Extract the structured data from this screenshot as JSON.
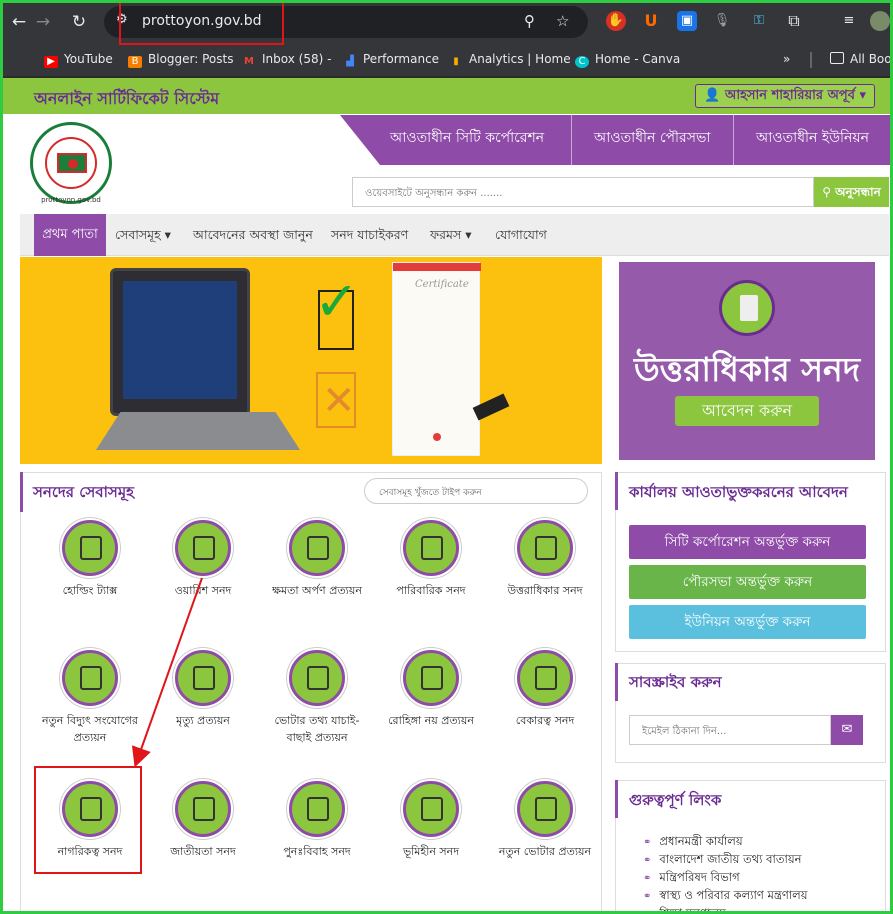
{
  "browser": {
    "url": "prottoyon.gov.bd",
    "bookmarks": [
      {
        "label": "YouTube",
        "icon": "youtube-icon",
        "color": "#ff0000"
      },
      {
        "label": "Blogger: Posts",
        "icon": "blogger-icon",
        "color": "#f57d00"
      },
      {
        "label": "Inbox (58) -",
        "icon": "gmail-icon",
        "color": "#ea4335"
      },
      {
        "label": "Performance",
        "icon": "performance-icon",
        "color": "#4285f4"
      },
      {
        "label": "Analytics | Home",
        "icon": "analytics-icon",
        "color": "#f9ab00"
      },
      {
        "label": "Home - Canva",
        "icon": "canva-icon",
        "color": "#00c4cc"
      }
    ],
    "more_label": "»",
    "all_bookmarks_label": "All Boo"
  },
  "site": {
    "topbar_title": "অনলাইন সার্টিফিকেট সিস্টেম",
    "user_name": "আহসান শাহারিয়ার অপূর্ব",
    "logo_caption": "prottoyon.gov.bd",
    "top_nav": [
      "আওতাধীন সিটি কর্পোরেশন",
      "আওতাধীন পৌরসভা",
      "আওতাধীন ইউনিয়ন"
    ],
    "search_placeholder": "ওয়েবসাইটে অনুসন্ধান করুন .......",
    "search_button": "অনুসন্ধান",
    "menu": {
      "home": "প্রথম পাতা",
      "services": "সেবাসমূহ",
      "status": "আবেদনের অবস্থা জানুন",
      "verify": "সনদ যাচাইকরণ",
      "forms": "ফরমস",
      "contact": "যোগাযোগ"
    },
    "banner": {
      "certificate_word": "Certificate"
    },
    "side_ad": {
      "title": "উত্তরাধিকার সনদ",
      "button": "আবেদন করুন"
    }
  },
  "services_panel": {
    "title": "সনদের সেবাসমূহ",
    "search_placeholder": "সেবাসমূহ খুঁজতে টাইপ করুন",
    "items": [
      {
        "label": "হোল্ডিং ট্যাক্স",
        "icon": "house-tax-icon"
      },
      {
        "label": "ওয়ারিশ সনদ",
        "icon": "heir-icon"
      },
      {
        "label": "ক্ষমতা অর্পণ প্রত্যয়ন",
        "icon": "delegation-icon"
      },
      {
        "label": "পারিবারিক সনদ",
        "icon": "family-icon"
      },
      {
        "label": "উত্তরাধিকার সনদ",
        "icon": "inheritance-icon"
      },
      {
        "label": "নতুন বিদ্যুৎ সংযোগের",
        "label2": "প্রত্যয়ন",
        "icon": "electricity-meter-icon"
      },
      {
        "label": "মৃত্যু প্রত্যয়ন",
        "icon": "footprint-icon"
      },
      {
        "label": "ভোটার তথ্য যাচাই-",
        "label2": "বাছাই প্রত্যয়ন",
        "icon": "voter-check-icon"
      },
      {
        "label": "রোহিঙ্গা নয় প্রত্যয়ন",
        "icon": "globe-person-icon"
      },
      {
        "label": "বেকারত্ব সনদ",
        "icon": "unemployment-icon"
      },
      {
        "label": "নাগরিকত্ব সনদ",
        "icon": "id-card-icon"
      },
      {
        "label": "জাতীয়তা সনদ",
        "icon": "nationality-card-icon"
      },
      {
        "label": "পুনঃবিবাহ সনদ",
        "icon": "couple-icon"
      },
      {
        "label": "ভূমিহীন সনদ",
        "icon": "landless-icon"
      },
      {
        "label": "নতুন ভোটার প্রত্যয়ন",
        "icon": "new-voter-icon"
      }
    ]
  },
  "office_panel": {
    "title": "কার্যালয় আওতাভুক্তকরনের আবেদন",
    "buttons": [
      {
        "label": "সিটি কর্পোরেশন অন্তর্ভুক্ত করুন",
        "color": "#8e4ba7"
      },
      {
        "label": "পৌরসভা অন্তর্ভুক্ত করুন",
        "color": "#6ab54a"
      },
      {
        "label": "ইউনিয়ন অন্তর্ভুক্ত করুন",
        "color": "#5bc0de"
      }
    ]
  },
  "subscribe_panel": {
    "title": "সাবস্ক্রাইব করুন",
    "email_placeholder": "ইমেইল ঠিকানা দিন..."
  },
  "links_panel": {
    "title": "গুরুত্বপূর্ণ লিংক",
    "links": [
      "প্রধানমন্ত্রী কার্যালয়",
      "বাংলাদেশ জাতীয় তথ্য বাতায়ন",
      "মন্ত্রিপরিষদ বিভাগ",
      "স্বাস্থ্য ও পরিবার কল্যাণ মন্ত্রণালয়",
      "শিক্ষা মন্ত্রণালয়"
    ]
  }
}
